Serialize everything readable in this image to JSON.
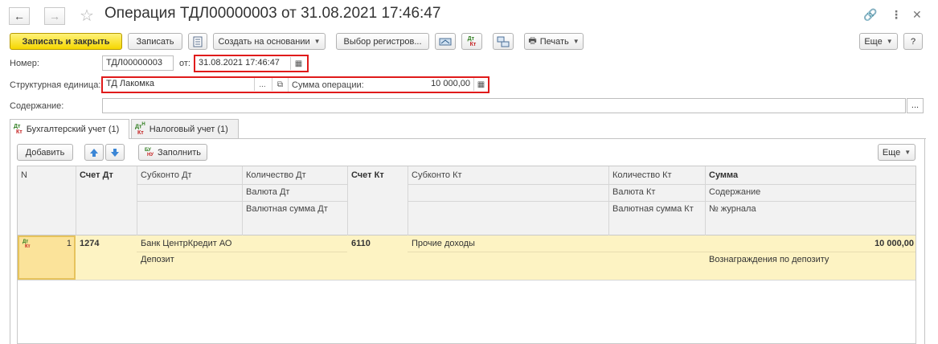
{
  "window": {
    "title": "Операция ТДЛ00000003 от 31.08.2021 17:46:47"
  },
  "toolbar": {
    "save_close_label": "Записать и закрыть",
    "save_label": "Записать",
    "create_based_label": "Создать на основании",
    "register_select_label": "Выбор регистров...",
    "print_label": "Печать",
    "more_label": "Еще",
    "help_label": "?"
  },
  "form": {
    "number_label": "Номер:",
    "number_value": "ТДЛ00000003",
    "date_label": "от:",
    "date_value": "31.08.2021 17:46:47",
    "unit_label": "Структурная единица:",
    "unit_value": "ТД Лакомка",
    "sum_label": "Сумма операции:",
    "sum_value": "10 000,00",
    "content_label": "Содержание:",
    "content_value": "",
    "select_dots": "..."
  },
  "tabs": [
    {
      "label": "Бухгалтерский учет (1)",
      "active": true
    },
    {
      "label": "Налоговый учет (1)",
      "active": false
    }
  ],
  "icons": {
    "dt_text": "Дт",
    "kt_text": "Кт",
    "dtkt_tax_text": "Дт",
    "kt_tax_text": "Кт",
    "tax_superscript": "Н",
    "fill_icon_top": "БУ",
    "fill_icon_bottom": "НУ"
  },
  "table_toolbar": {
    "add_label": "Добавить",
    "fill_label": "Заполнить",
    "more_label": "Еще"
  },
  "table": {
    "headers": {
      "n": "N",
      "account_dt": "Счет Дт",
      "subconto_dt": "Субконто Дт",
      "qty_dt": "Количество Дт",
      "currency_dt": "Валюта Дт",
      "cur_sum_dt": "Валютная сумма Дт",
      "account_kt": "Счет Кт",
      "subconto_kt": "Субконто Кт",
      "qty_kt": "Количество Кт",
      "currency_kt": "Валюта Кт",
      "cur_sum_kt": "Валютная сумма Кт",
      "sum": "Сумма",
      "content": "Содержание",
      "journal": "№ журнала"
    },
    "rows": [
      {
        "n": "1",
        "account_dt": "1274",
        "subconto_dt_1": "Банк ЦентрКредит АО",
        "subconto_dt_2": "Депозит",
        "account_kt": "6110",
        "subconto_kt_1": "Прочие доходы",
        "sum": "10 000,00",
        "content": "Вознаграждения по депозиту"
      }
    ]
  },
  "colors": {
    "primary_button": "#f5d700",
    "highlight_border": "#e01b1b",
    "row_highlight": "#fdf3c3",
    "selected_cell": "#fbe39a"
  }
}
